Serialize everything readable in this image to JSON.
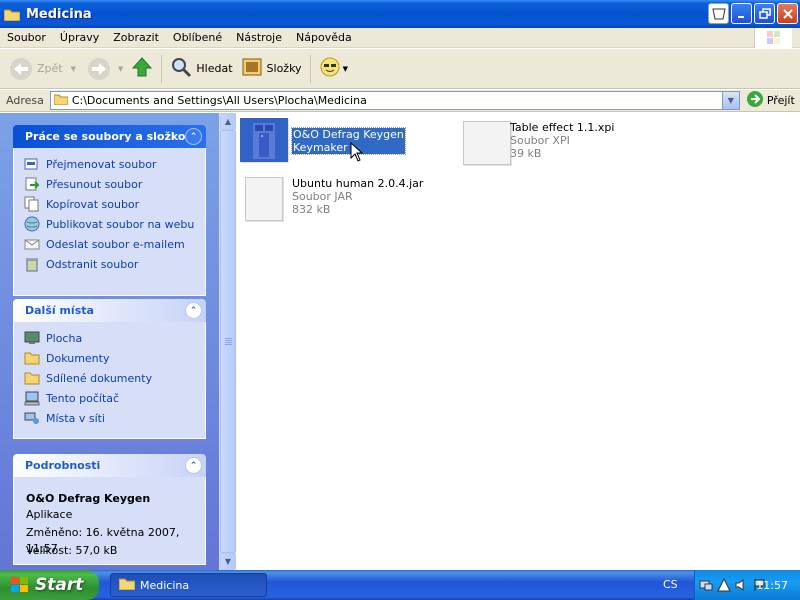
{
  "window": {
    "title": "Medicina"
  },
  "menu": [
    "Soubor",
    "Úpravy",
    "Zobrazit",
    "Oblíbené",
    "Nástroje",
    "Nápověda"
  ],
  "toolbar": {
    "back": "Zpět",
    "search": "Hledat",
    "folders": "Složky"
  },
  "address": {
    "label": "Adresa",
    "path": "C:\\Documents and Settings\\All Users\\Plocha\\Medicina",
    "go": "Přejít"
  },
  "tasks_panel": {
    "title": "Práce se soubory a složkou",
    "items": [
      "Přejmenovat soubor",
      "Přesunout soubor",
      "Kopírovat soubor",
      "Publikovat soubor na webu",
      "Odeslat soubor e-mailem",
      "Odstranit soubor"
    ]
  },
  "places_panel": {
    "title": "Další místa",
    "items": [
      "Plocha",
      "Dokumenty",
      "Sdílené dokumenty",
      "Tento počítač",
      "Místa v síti"
    ]
  },
  "details_panel": {
    "title": "Podrobnosti",
    "name": "O&O Defrag Keygen",
    "type": "Aplikace",
    "modified": "Změněno: 16. května 2007, 11:57",
    "size": "Velikost: 57,0 kB"
  },
  "files": [
    {
      "name_line1": "O&O Defrag Keygen",
      "name_line2": "Keymaker",
      "selected": true
    },
    {
      "name": "Table effect 1.1.xpi",
      "type": "Soubor XPI",
      "size": "39 kB"
    },
    {
      "name": "Ubuntu human 2.0.4.jar",
      "type": "Soubor JAR",
      "size": "832 kB"
    }
  ],
  "taskbar": {
    "start": "Start",
    "window_button": "Medicina",
    "language": "CS",
    "clock": "11:57"
  },
  "colors": {
    "titlebar": "#0553d0",
    "selection": "#316ac5",
    "start_green": "#3c9a3c",
    "panel_text": "#0c3fad"
  }
}
